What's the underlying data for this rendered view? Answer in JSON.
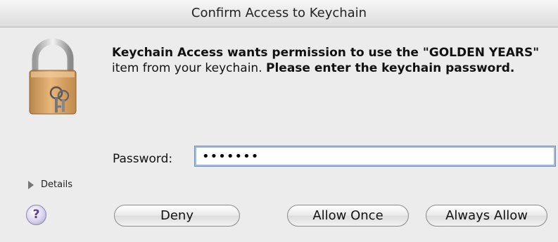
{
  "window": {
    "title": "Confirm Access to Keychain"
  },
  "message": {
    "segments": [
      {
        "text": "Keychain Access wants permission to use the \"GOLDEN YEARS\"",
        "weight": "bold"
      },
      {
        "text": " item from your keychain. ",
        "weight": "normal"
      },
      {
        "text": "Please enter the keychain password.",
        "weight": "bold"
      }
    ]
  },
  "password": {
    "label": "Password:",
    "value": "•••••••"
  },
  "details": {
    "label": "Details"
  },
  "help": {
    "label": "?"
  },
  "buttons": {
    "deny": "Deny",
    "allow_once": "Allow Once",
    "always_allow": "Always Allow"
  },
  "icons": {
    "lock": "padlock-with-keys-icon",
    "details": "disclosure-triangle-icon",
    "help": "help-icon"
  }
}
